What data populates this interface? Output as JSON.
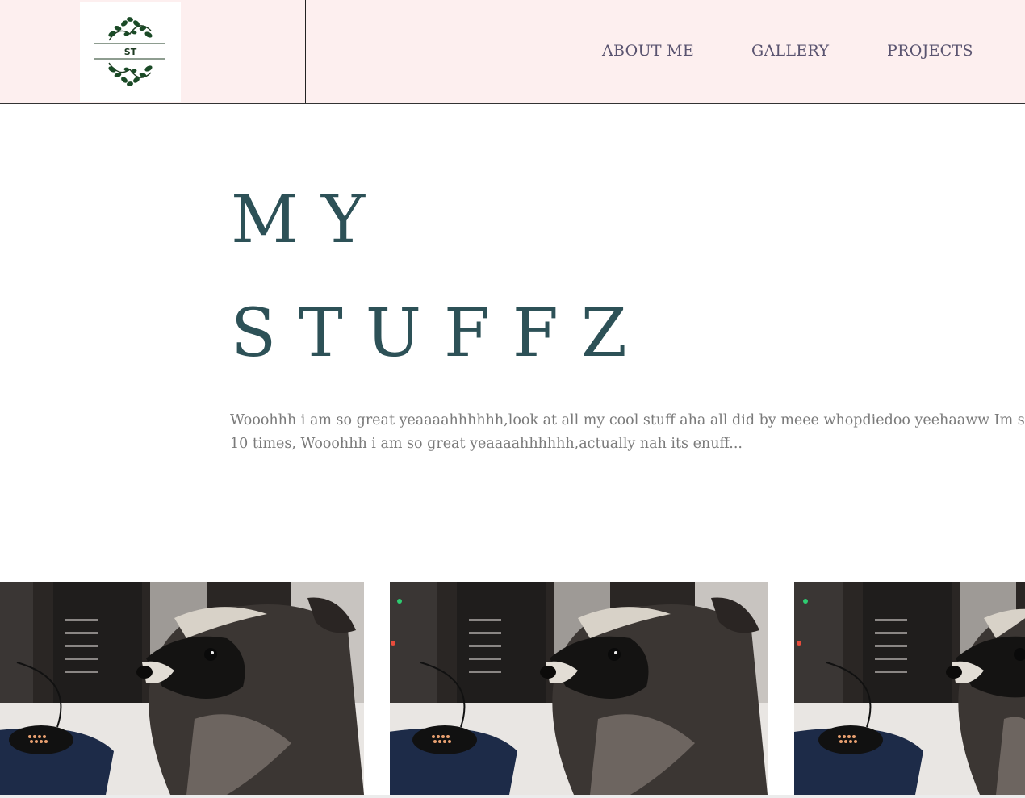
{
  "header": {
    "logo_text": "ST",
    "nav": [
      {
        "label": "ABOUT ME"
      },
      {
        "label": "GALLERY"
      },
      {
        "label": "PROJECTS"
      }
    ]
  },
  "hero": {
    "title_line1": "MY",
    "title_line2": "STUFFZ",
    "description_line1": "Wooohhh i am so great yeaaaahhhhhh,look at all my cool stuff aha all did by meee whopdiedoo yeehaaww Im so",
    "description_line2": "10 times, Wooohhh i am so great yeaaaahhhhhh,actually nah its enuff..."
  },
  "gallery": {
    "items": [
      {
        "subject": "raccoon-photo"
      },
      {
        "subject": "raccoon-photo"
      },
      {
        "subject": "raccoon-photo"
      }
    ]
  },
  "colors": {
    "header_bg": "#fdefef",
    "title": "#2d5157",
    "nav_text": "#5a5470",
    "body_text": "#7a7a7a"
  }
}
